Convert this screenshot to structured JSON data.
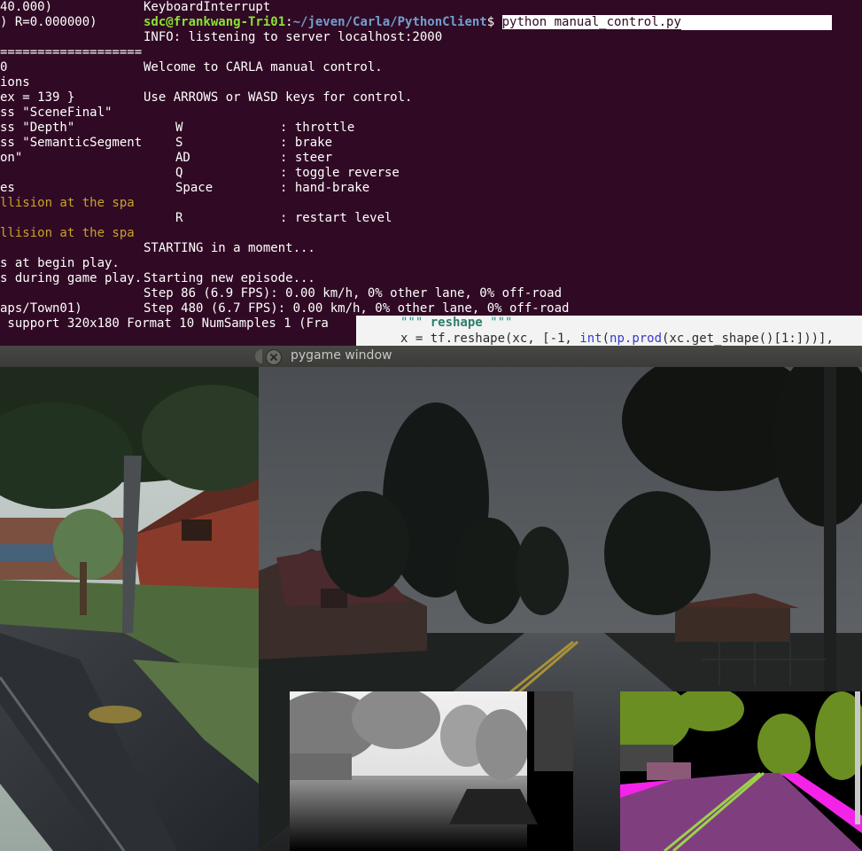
{
  "background_terminal": {
    "lines": [
      {
        "text": "40.000)",
        "style": "normal"
      },
      {
        "text": ") R=0.000000)",
        "style": "normal"
      },
      {
        "text": "",
        "style": "normal"
      },
      {
        "text": "=======================",
        "style": "normal"
      },
      {
        "text": "0",
        "style": "normal"
      },
      {
        "text": "ions",
        "style": "normal"
      },
      {
        "text": "ex = 139 }",
        "style": "normal"
      },
      {
        "text": "ss \"SceneFinal\"",
        "style": "normal"
      },
      {
        "text": "ss \"Depth\"",
        "style": "normal"
      },
      {
        "text": "ss \"SemanticSegment",
        "style": "normal"
      },
      {
        "text": "on\"",
        "style": "normal"
      },
      {
        "text": "",
        "style": "normal"
      },
      {
        "text": "es",
        "style": "normal"
      },
      {
        "text": "llision at the spa",
        "style": "warn"
      },
      {
        "text": "",
        "style": "normal"
      },
      {
        "text": "llision at the spa",
        "style": "warn"
      },
      {
        "text": "",
        "style": "normal"
      },
      {
        "text": "s at begin play.",
        "style": "normal"
      },
      {
        "text": "s during game play.",
        "style": "normal"
      },
      {
        "text": "",
        "style": "normal"
      },
      {
        "text": "aps/Town01)",
        "style": "normal"
      },
      {
        "text": " support 320x180 Format 10 NumSamples 1 (Fra",
        "style": "normal"
      }
    ]
  },
  "code_editor": {
    "line1": {
      "q1": "\"\"\" ",
      "kw": "reshape",
      "q2": " \"\"\""
    },
    "line2": {
      "pre": "x = tf.reshape(xc, [-1, ",
      "fn1": "int",
      "mid": "(",
      "fn2": "np.prod",
      "post": "(xc.get_shape()[1:]))],"
    }
  },
  "main_terminal": {
    "line_keyboard_interrupt": "KeyboardInterrupt",
    "prompt_user": "sdc@frankwang-Tri01",
    "prompt_sep": ":",
    "prompt_path": "~/jeven/Carla/PythonClient",
    "prompt_symbol": "$ ",
    "command": "python manual_control.py",
    "info_line": "INFO: listening to server localhost:2000",
    "welcome": "Welcome to CARLA manual control.",
    "use_keys": "Use ARROWS or WASD keys for control.",
    "controls": [
      {
        "key": "W",
        "action": "throttle"
      },
      {
        "key": "S",
        "action": "brake"
      },
      {
        "key": "AD",
        "action": "steer"
      },
      {
        "key": "Q",
        "action": "toggle reverse"
      },
      {
        "key": "Space",
        "action": "hand-brake"
      }
    ],
    "restart": {
      "key": "R",
      "action": "restart level"
    },
    "starting": "STARTING in a moment...",
    "new_episode": "Starting new episode...",
    "steps": [
      "Step 86 (6.9 FPS): 0.00 km/h, 0% other lane, 0% off-road",
      "Step 480 (6.7 FPS): 0.00 km/h, 0% other lane, 0% off-road"
    ]
  },
  "pygame_window": {
    "title": "pygame window",
    "views": {
      "rgb": "rgb-camera-view",
      "depth": "depth-camera-view",
      "semantic": "semantic-segmentation-view"
    }
  },
  "colors": {
    "terminal_bg": "#300a24",
    "prompt_user": "#8ae234",
    "prompt_path": "#729fcf",
    "warning": "#c9a227",
    "titlebar": "#3b3b39"
  }
}
